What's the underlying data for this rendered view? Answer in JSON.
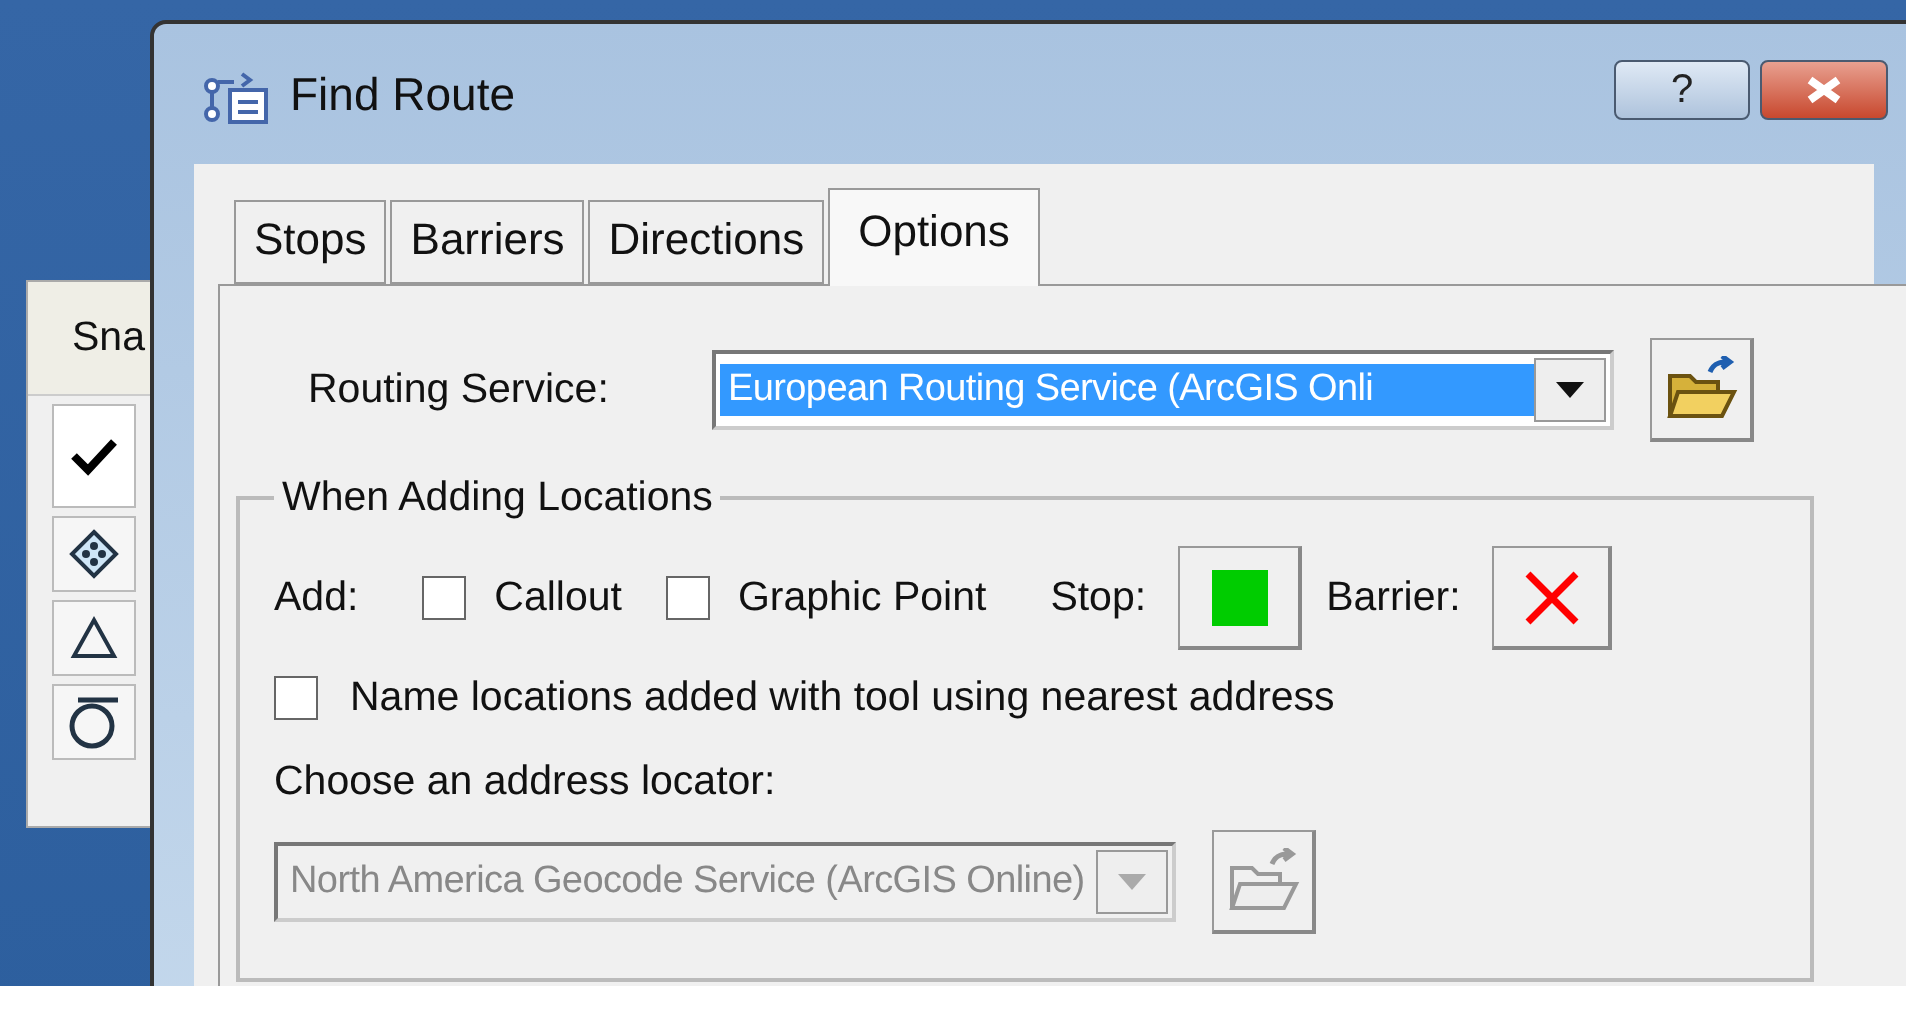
{
  "back_window": {
    "header": "Sna",
    "checked": true,
    "items": [
      {
        "kind": "diamond"
      },
      {
        "kind": "triangle"
      },
      {
        "kind": "sigma"
      }
    ]
  },
  "window": {
    "title": "Find Route",
    "help": "?"
  },
  "tabs": [
    {
      "label": "Stops",
      "selected": false
    },
    {
      "label": "Barriers",
      "selected": false
    },
    {
      "label": "Directions",
      "selected": false
    },
    {
      "label": "Options",
      "selected": true
    }
  ],
  "routing_service": {
    "label": "Routing Service:",
    "value": "European Routing Service (ArcGIS Onli",
    "highlighted": true,
    "disabled": false
  },
  "group": {
    "title": "When Adding Locations",
    "add_label": "Add:",
    "add_options": [
      {
        "label": "Callout",
        "checked": false
      },
      {
        "label": "Graphic Point",
        "checked": false
      }
    ],
    "stop_label": "Stop:",
    "barrier_label": "Barrier:",
    "name_locations": {
      "label": "Name locations added with tool using nearest address",
      "checked": false
    },
    "locator_label": "Choose an address locator:",
    "locator": {
      "value": "North America Geocode Service (ArcGIS Online)",
      "highlighted": false,
      "disabled": true
    }
  }
}
